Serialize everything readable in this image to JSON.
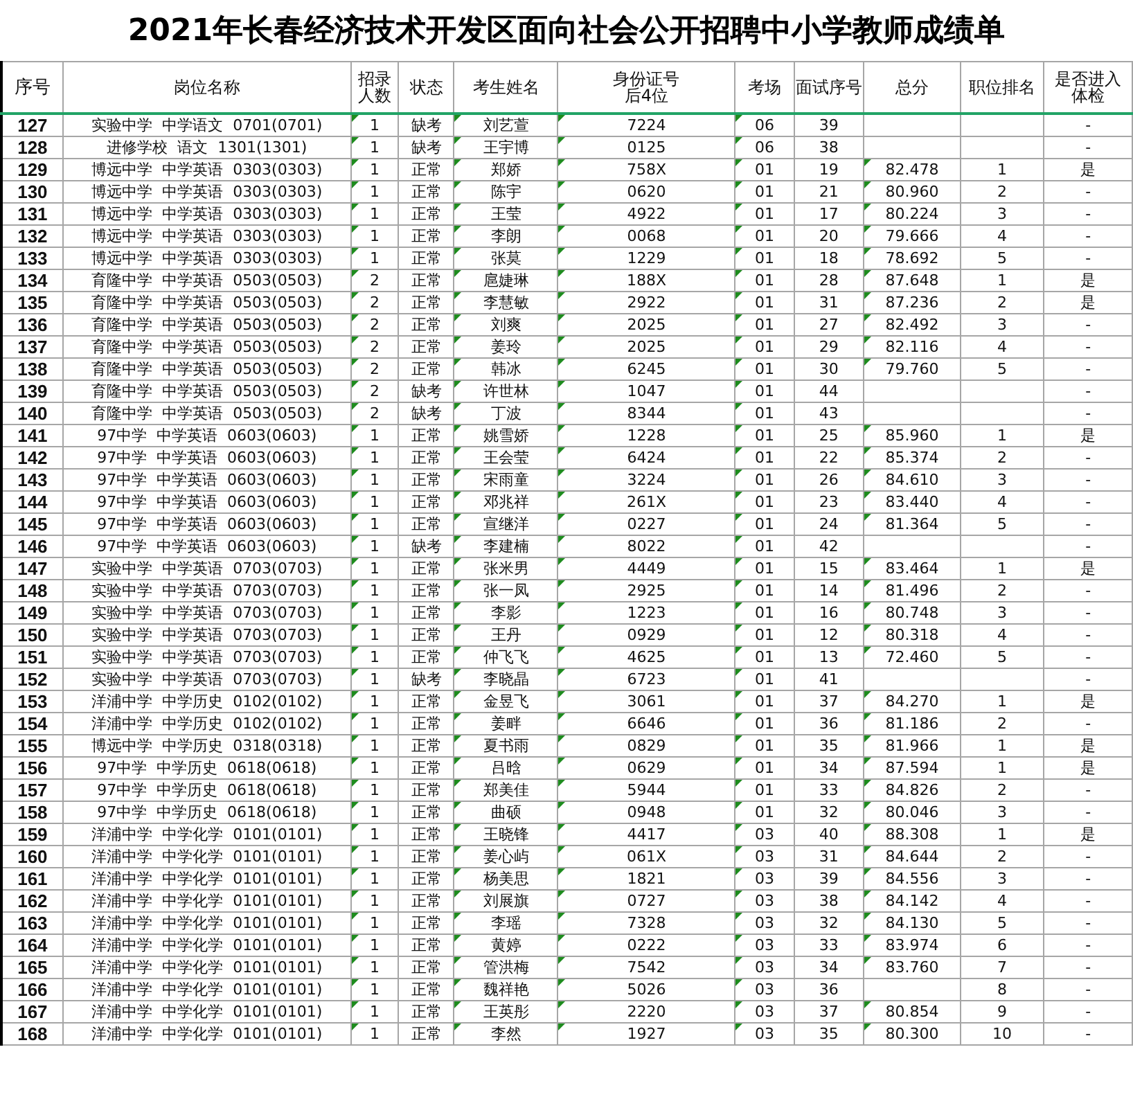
{
  "title": "2021年长春经济技术开发区面向社会公开招聘中小学教师成绩单",
  "columns": [
    "序号",
    "岗位名称",
    "招录人数",
    "状态",
    "考生姓名",
    "身份证号后4位",
    "考场",
    "面试序号",
    "总分",
    "职位排名",
    "是否进入体检"
  ],
  "rows": [
    {
      "cells": [
        "127",
        "实验中学  中学语文  0701(0701)",
        "1",
        "缺考",
        "刘艺萱",
        "7224",
        "06",
        "39",
        "",
        "",
        "-"
      ]
    },
    {
      "cells": [
        "128",
        "进修学校  语文  1301(1301)",
        "1",
        "缺考",
        "王宇博",
        "0125",
        "06",
        "38",
        "",
        "",
        "-"
      ]
    },
    {
      "cells": [
        "129",
        "博远中学  中学英语  0303(0303)",
        "1",
        "正常",
        "郑娇",
        "758X",
        "01",
        "19",
        "82.478",
        "1",
        "是"
      ]
    },
    {
      "cells": [
        "130",
        "博远中学  中学英语  0303(0303)",
        "1",
        "正常",
        "陈宇",
        "0620",
        "01",
        "21",
        "80.960",
        "2",
        "-"
      ]
    },
    {
      "cells": [
        "131",
        "博远中学  中学英语  0303(0303)",
        "1",
        "正常",
        "王莹",
        "4922",
        "01",
        "17",
        "80.224",
        "3",
        "-"
      ]
    },
    {
      "cells": [
        "132",
        "博远中学  中学英语  0303(0303)",
        "1",
        "正常",
        "李朗",
        "0068",
        "01",
        "20",
        "79.666",
        "4",
        "-"
      ]
    },
    {
      "cells": [
        "133",
        "博远中学  中学英语  0303(0303)",
        "1",
        "正常",
        "张莫",
        "1229",
        "01",
        "18",
        "78.692",
        "5",
        "-"
      ]
    },
    {
      "cells": [
        "134",
        "育隆中学  中学英语  0503(0503)",
        "2",
        "正常",
        "扈婕琳",
        "188X",
        "01",
        "28",
        "87.648",
        "1",
        "是"
      ]
    },
    {
      "cells": [
        "135",
        "育隆中学  中学英语  0503(0503)",
        "2",
        "正常",
        "李慧敏",
        "2922",
        "01",
        "31",
        "87.236",
        "2",
        "是"
      ]
    },
    {
      "cells": [
        "136",
        "育隆中学  中学英语  0503(0503)",
        "2",
        "正常",
        "刘爽",
        "2025",
        "01",
        "27",
        "82.492",
        "3",
        "-"
      ]
    },
    {
      "cells": [
        "137",
        "育隆中学  中学英语  0503(0503)",
        "2",
        "正常",
        "姜玲",
        "2025",
        "01",
        "29",
        "82.116",
        "4",
        "-"
      ]
    },
    {
      "cells": [
        "138",
        "育隆中学  中学英语  0503(0503)",
        "2",
        "正常",
        "韩冰",
        "6245",
        "01",
        "30",
        "79.760",
        "5",
        "-"
      ]
    },
    {
      "cells": [
        "139",
        "育隆中学  中学英语  0503(0503)",
        "2",
        "缺考",
        "许世林",
        "1047",
        "01",
        "44",
        "",
        "",
        "-"
      ]
    },
    {
      "cells": [
        "140",
        "育隆中学  中学英语  0503(0503)",
        "2",
        "缺考",
        "丁波",
        "8344",
        "01",
        "43",
        "",
        "",
        "-"
      ]
    },
    {
      "cells": [
        "141",
        "97中学  中学英语  0603(0603)",
        "1",
        "正常",
        "姚雪娇",
        "1228",
        "01",
        "25",
        "85.960",
        "1",
        "是"
      ]
    },
    {
      "cells": [
        "142",
        "97中学  中学英语  0603(0603)",
        "1",
        "正常",
        "王会莹",
        "6424",
        "01",
        "22",
        "85.374",
        "2",
        "-"
      ]
    },
    {
      "cells": [
        "143",
        "97中学  中学英语  0603(0603)",
        "1",
        "正常",
        "宋雨童",
        "3224",
        "01",
        "26",
        "84.610",
        "3",
        "-"
      ]
    },
    {
      "cells": [
        "144",
        "97中学  中学英语  0603(0603)",
        "1",
        "正常",
        "邓兆祥",
        "261X",
        "01",
        "23",
        "83.440",
        "4",
        "-"
      ]
    },
    {
      "cells": [
        "145",
        "97中学  中学英语  0603(0603)",
        "1",
        "正常",
        "宣继洋",
        "0227",
        "01",
        "24",
        "81.364",
        "5",
        "-"
      ]
    },
    {
      "cells": [
        "146",
        "97中学  中学英语  0603(0603)",
        "1",
        "缺考",
        "李建楠",
        "8022",
        "01",
        "42",
        "",
        "",
        "-"
      ]
    },
    {
      "cells": [
        "147",
        "实验中学  中学英语  0703(0703)",
        "1",
        "正常",
        "张米男",
        "4449",
        "01",
        "15",
        "83.464",
        "1",
        "是"
      ]
    },
    {
      "cells": [
        "148",
        "实验中学  中学英语  0703(0703)",
        "1",
        "正常",
        "张一凤",
        "2925",
        "01",
        "14",
        "81.496",
        "2",
        "-"
      ]
    },
    {
      "cells": [
        "149",
        "实验中学  中学英语  0703(0703)",
        "1",
        "正常",
        "李影",
        "1223",
        "01",
        "16",
        "80.748",
        "3",
        "-"
      ]
    },
    {
      "cells": [
        "150",
        "实验中学  中学英语  0703(0703)",
        "1",
        "正常",
        "王丹",
        "0929",
        "01",
        "12",
        "80.318",
        "4",
        "-"
      ]
    },
    {
      "cells": [
        "151",
        "实验中学  中学英语  0703(0703)",
        "1",
        "正常",
        "仲飞飞",
        "4625",
        "01",
        "13",
        "72.460",
        "5",
        "-"
      ]
    },
    {
      "cells": [
        "152",
        "实验中学  中学英语  0703(0703)",
        "1",
        "缺考",
        "李晓晶",
        "6723",
        "01",
        "41",
        "",
        "",
        "-"
      ]
    },
    {
      "cells": [
        "153",
        "洋浦中学  中学历史  0102(0102)",
        "1",
        "正常",
        "金昱飞",
        "3061",
        "01",
        "37",
        "84.270",
        "1",
        "是"
      ]
    },
    {
      "cells": [
        "154",
        "洋浦中学  中学历史  0102(0102)",
        "1",
        "正常",
        "姜畔",
        "6646",
        "01",
        "36",
        "81.186",
        "2",
        "-"
      ]
    },
    {
      "cells": [
        "155",
        "博远中学  中学历史  0318(0318)",
        "1",
        "正常",
        "夏书雨",
        "0829",
        "01",
        "35",
        "81.966",
        "1",
        "是"
      ]
    },
    {
      "cells": [
        "156",
        "97中学  中学历史  0618(0618)",
        "1",
        "正常",
        "吕晗",
        "0629",
        "01",
        "34",
        "87.594",
        "1",
        "是"
      ]
    },
    {
      "cells": [
        "157",
        "97中学  中学历史  0618(0618)",
        "1",
        "正常",
        "郑美佳",
        "5944",
        "01",
        "33",
        "84.826",
        "2",
        "-"
      ]
    },
    {
      "cells": [
        "158",
        "97中学  中学历史  0618(0618)",
        "1",
        "正常",
        "曲硕",
        "0948",
        "01",
        "32",
        "80.046",
        "3",
        "-"
      ]
    },
    {
      "cells": [
        "159",
        "洋浦中学  中学化学  0101(0101)",
        "1",
        "正常",
        "王晓锋",
        "4417",
        "03",
        "40",
        "88.308",
        "1",
        "是"
      ]
    },
    {
      "cells": [
        "160",
        "洋浦中学  中学化学  0101(0101)",
        "1",
        "正常",
        "姜心屿",
        "061X",
        "03",
        "31",
        "84.644",
        "2",
        "-"
      ]
    },
    {
      "cells": [
        "161",
        "洋浦中学  中学化学  0101(0101)",
        "1",
        "正常",
        "杨美思",
        "1821",
        "03",
        "39",
        "84.556",
        "3",
        "-"
      ]
    },
    {
      "cells": [
        "162",
        "洋浦中学  中学化学  0101(0101)",
        "1",
        "正常",
        "刘展旗",
        "0727",
        "03",
        "38",
        "84.142",
        "4",
        "-"
      ]
    },
    {
      "cells": [
        "163",
        "洋浦中学  中学化学  0101(0101)",
        "1",
        "正常",
        "李瑶",
        "7328",
        "03",
        "32",
        "84.130",
        "5",
        "-"
      ]
    },
    {
      "cells": [
        "164",
        "洋浦中学  中学化学  0101(0101)",
        "1",
        "正常",
        "黄婷",
        "0222",
        "03",
        "33",
        "83.974",
        "6",
        "-"
      ]
    },
    {
      "cells": [
        "165",
        "洋浦中学  中学化学  0101(0101)",
        "1",
        "正常",
        "管洪梅",
        "7542",
        "03",
        "34",
        "83.760",
        "7",
        "-"
      ]
    },
    {
      "cells": [
        "166",
        "洋浦中学  中学化学  0101(0101)",
        "1",
        "正常",
        "魏祥艳",
        "5026",
        "03",
        "36",
        "",
        "8",
        "-"
      ]
    },
    {
      "cells": [
        "167",
        "洋浦中学  中学化学  0101(0101)",
        "1",
        "正常",
        "王英彤",
        "2220",
        "03",
        "37",
        "80.854",
        "9",
        "-"
      ]
    },
    {
      "cells": [
        "168",
        "洋浦中学  中学化学  0101(0101)",
        "1",
        "正常",
        "李然",
        "1927",
        "03",
        "35",
        "80.300",
        "10",
        "-"
      ]
    }
  ]
}
